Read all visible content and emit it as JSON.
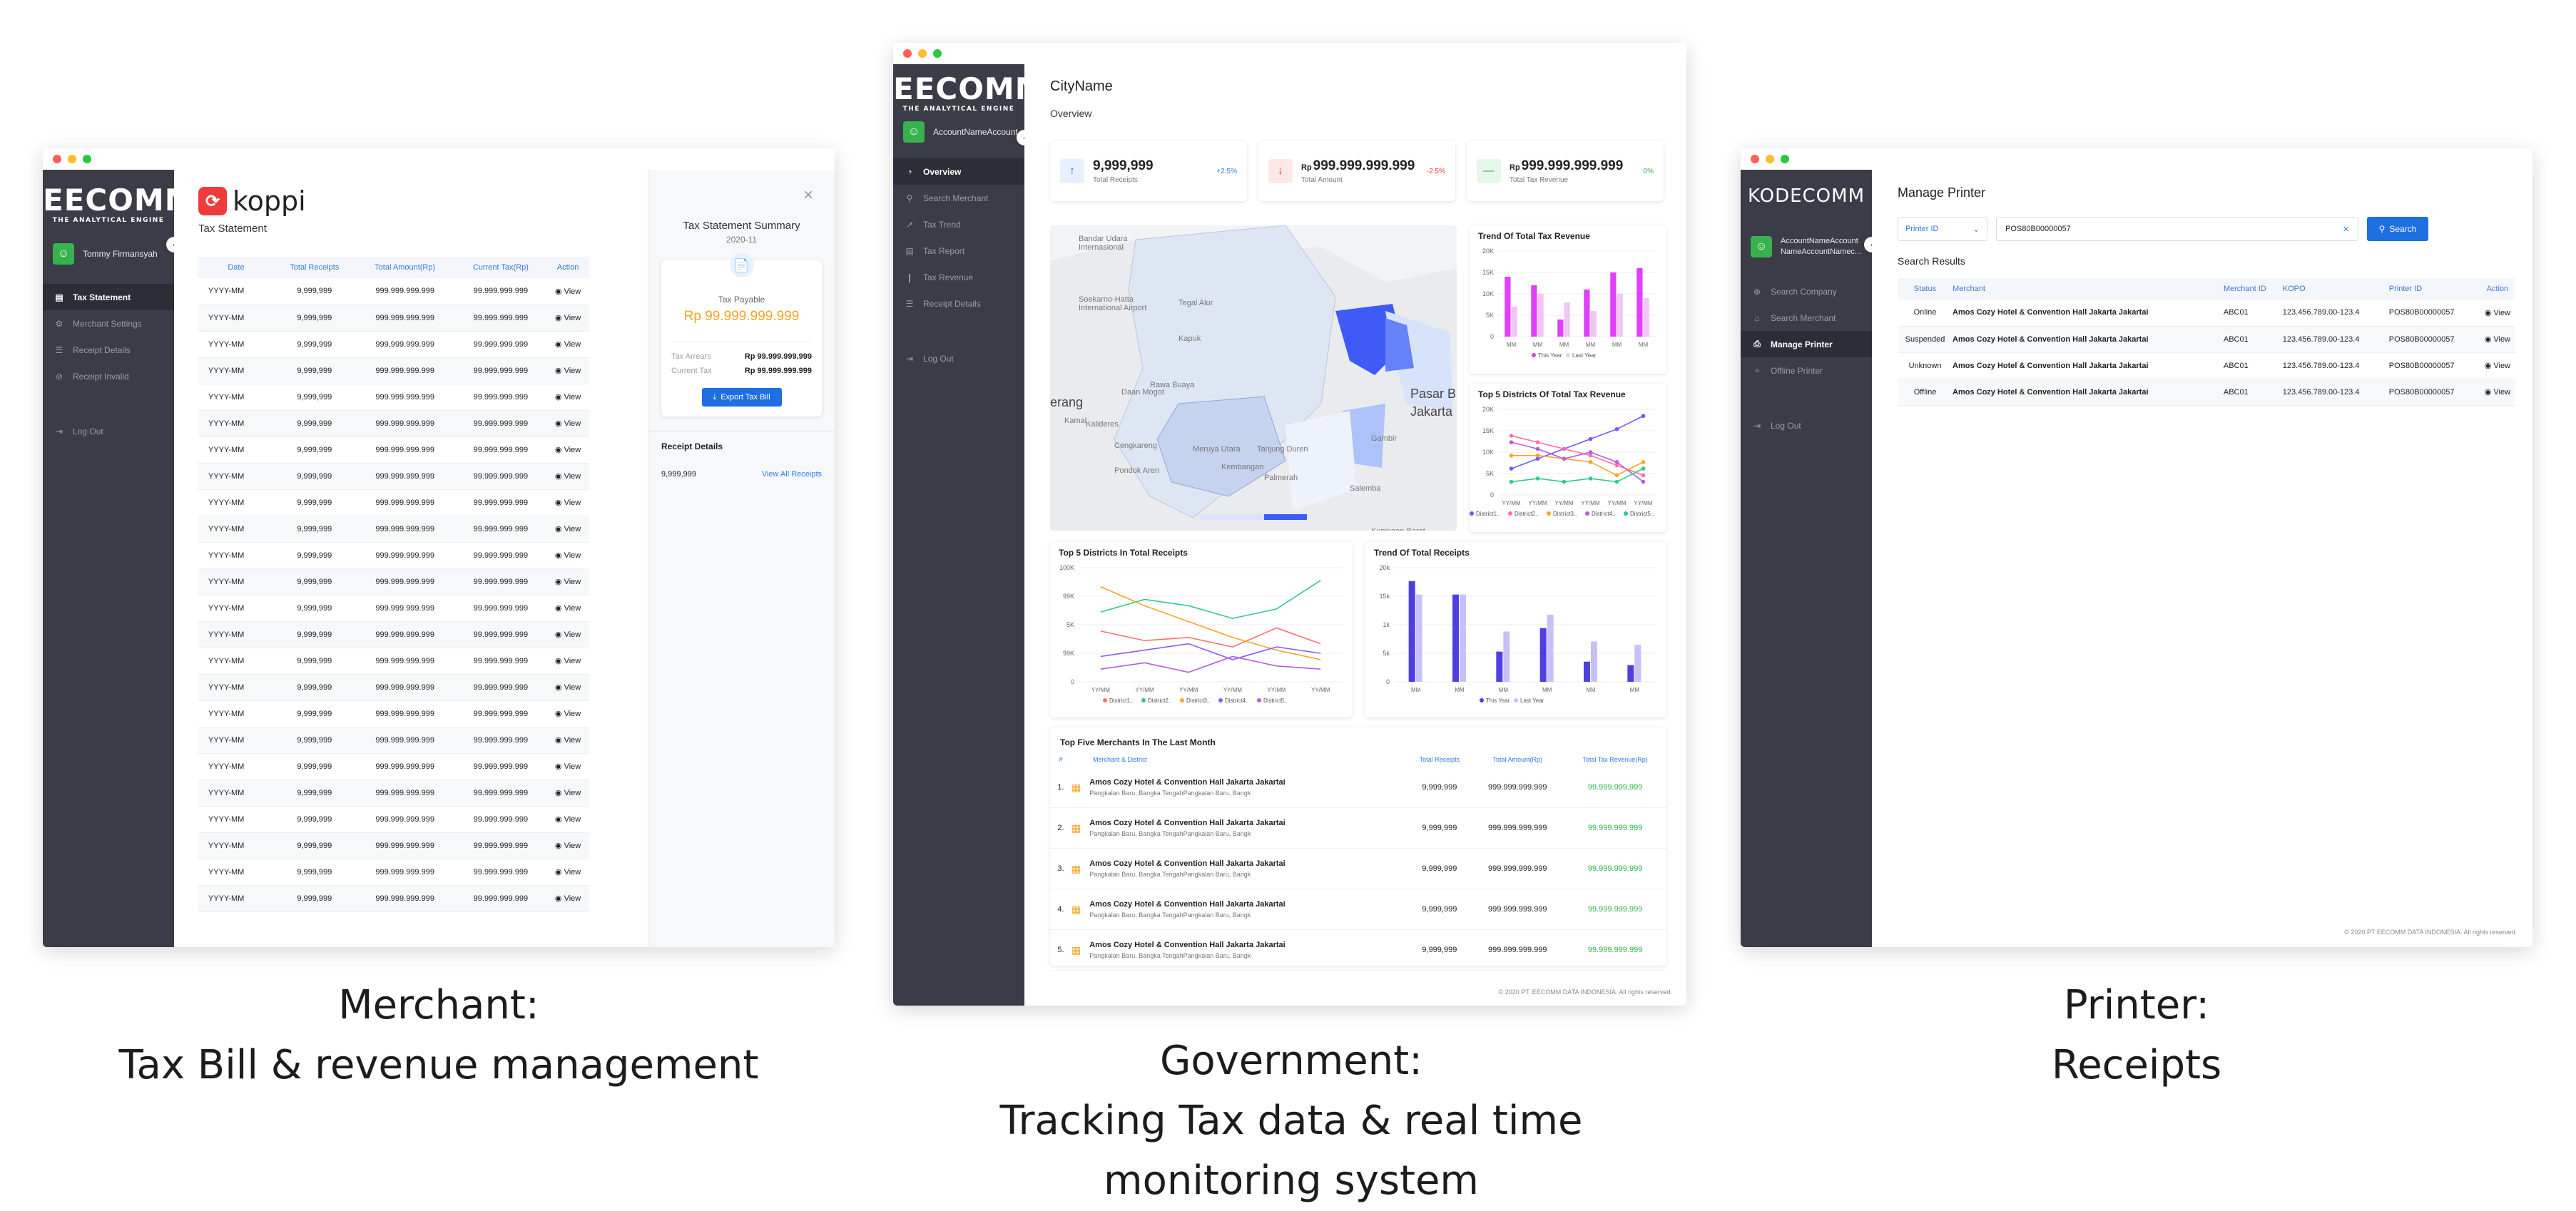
{
  "colors": {
    "sidebar": "#3b3c47",
    "accent": "#1e6fe0",
    "green": "#2fb344",
    "orange": "#f5a524",
    "red": "#e53935",
    "magenta": "#e040fb",
    "purple": "#5b3fe0"
  },
  "captions": {
    "merchant": [
      "Merchant:",
      "Tax Bill & revenue management"
    ],
    "government": [
      "Government:",
      "Tracking Tax data & real time",
      "monitoring system"
    ],
    "printer": [
      "Printer:",
      "Receipts"
    ]
  },
  "merchant": {
    "logo": "EECOMM",
    "logo_tag": "THE ANALYTICAL ENGINE",
    "user": "Tommy Firmansyah",
    "nav": [
      {
        "label": "Tax Statement",
        "icon": "document-icon",
        "active": true
      },
      {
        "label": "Merchant Settings",
        "icon": "gear-icon"
      },
      {
        "label": "Receipt Details",
        "icon": "receipt-icon"
      },
      {
        "label": "Receipt Invalid",
        "icon": "block-icon"
      }
    ],
    "logout": "Log Out",
    "brand": "koppi",
    "page_title": "Tax Statement",
    "headers": [
      "Date",
      "Total Receipts",
      "Total Amount(Rp)",
      "Current Tax(Rp)",
      "Action"
    ],
    "row": {
      "date": "YYYY-MM",
      "receipts": "9,999,999",
      "amount": "999.999.999.999",
      "tax": "99.999.999.999",
      "action": "View"
    },
    "row_count": 24,
    "summary": {
      "title": "Tax Statement Summary",
      "period": "2020-11",
      "payable_label": "Tax Payable",
      "payable": "Rp 99.999.999.999",
      "arrears_label": "Tax Arrears",
      "arrears": "Rp 99.999.999.999",
      "current_label": "Current Tax",
      "current": "Rp 99.999.999.999",
      "export": "Export Tax Bill",
      "receipt_title": "Receipt Details",
      "receipt_value": "9,999,999",
      "view_all": "View All Receipts"
    }
  },
  "government": {
    "logo": "EECOMM",
    "logo_tag": "THE ANALYTICAL ENGINE",
    "user": "AccountNameAccount",
    "nav": [
      {
        "label": "Overview",
        "icon": "pie-icon",
        "active": true
      },
      {
        "label": "Search Merchant",
        "icon": "search-icon"
      },
      {
        "label": "Tax Trend",
        "icon": "trend-icon"
      },
      {
        "label": "Tax Report",
        "icon": "report-icon"
      },
      {
        "label": "Tax Revenue",
        "icon": "bar-chart-icon"
      },
      {
        "label": "Receipt Details",
        "icon": "receipt-icon"
      }
    ],
    "logout": "Log Out",
    "city": "CityName",
    "overview": "Overview",
    "kpis": [
      {
        "value": "9,999,999",
        "label": "Total Receipts",
        "delta": "+2.5%",
        "dir": "up",
        "color": "#2f7bea"
      },
      {
        "value": "999.999.999.999",
        "prefix": "Rp",
        "label": "Total Amount",
        "delta": "-2.5%",
        "dir": "down",
        "color": "#e53935"
      },
      {
        "value": "999.999.999.999",
        "prefix": "Rp",
        "label": "Total Tax Revenue",
        "delta": "0%",
        "dir": "flat",
        "color": "#2fb344"
      }
    ],
    "map_labels": [
      "Bandar Udara",
      "Internasional",
      "Soekarno-Hatta",
      "International Airport",
      "Tegal Alur",
      "erang",
      "Pasar B",
      "Jakarta",
      "Kalideres",
      "Kamal",
      "Rawa Buaya",
      "Daan Mogot",
      "Cengkareng",
      "Meruya Utara",
      "Kapuk",
      "Tanjung Duren",
      "Gambir",
      "Kembangan",
      "Palmerah",
      "Pondok Aren",
      "Salemba",
      "Kuningan Barat"
    ],
    "footer": "© 2020 PT. EECOMM DATA INDONESIA. All rights reserved."
  },
  "printer": {
    "logo": "KODECOMM",
    "user": "AccountNameAccount NameAccountNamec...",
    "nav": [
      {
        "label": "Search Company",
        "icon": "globe-icon"
      },
      {
        "label": "Search Merchant",
        "icon": "store-icon"
      },
      {
        "label": "Manage Printer",
        "icon": "printer-icon",
        "active": true
      },
      {
        "label": "Offline Printer",
        "icon": "wifi-off-icon"
      }
    ],
    "logout": "Log Out",
    "title": "Manage Printer",
    "filter": "Printer ID",
    "search_value": "POS80B00000057",
    "search_btn": "Search",
    "results_title": "Search Results",
    "headers": [
      "Status",
      "Merchant",
      "Merchant ID",
      "KOPO",
      "Printer ID",
      "Action"
    ],
    "rows": [
      {
        "status": "Online",
        "cls": "green",
        "merchant": "Amos Cozy Hotel & Convention Hall Jakarta Jakartai",
        "mid": "ABC01",
        "kopo": "123.456.789.00-123.4",
        "pid": "POS80B00000057",
        "action": "View"
      },
      {
        "status": "Suspended",
        "cls": "grey",
        "merchant": "Amos Cozy Hotel & Convention Hall Jakarta Jakartai",
        "mid": "ABC01",
        "kopo": "123.456.789.00-123.4",
        "pid": "POS80B00000057",
        "action": "View"
      },
      {
        "status": "Unknown",
        "cls": "orange",
        "merchant": "Amos Cozy Hotel & Convention Hall Jakarta Jakartai",
        "mid": "ABC01",
        "kopo": "123.456.789.00-123.4",
        "pid": "POS80B00000057",
        "action": "View"
      },
      {
        "status": "Offline",
        "cls": "red",
        "merchant": "Amos Cozy Hotel & Convention Hall Jakarta Jakartai",
        "mid": "ABC01",
        "kopo": "123.456.789.00-123.4",
        "pid": "POS80B00000057",
        "action": "View"
      }
    ],
    "footer": "© 2020 PT EECOMM DATA INDONESIA. All rights reserved."
  },
  "chart_data": [
    {
      "type": "bar",
      "title": "Trend Of Total Tax Revenue",
      "categories": [
        "MM",
        "MM",
        "MM",
        "MM",
        "MM",
        "MM"
      ],
      "series": [
        {
          "name": "This Year",
          "color": "#e040fb",
          "values": [
            140,
            120,
            40,
            110,
            150,
            160
          ]
        },
        {
          "name": "Last Year",
          "color": "#f3c4f7",
          "values": [
            70,
            100,
            80,
            60,
            100,
            90
          ]
        }
      ],
      "yticks": [
        "20K",
        "15K",
        "10K",
        "5K",
        "0"
      ],
      "ylim": [
        0,
        200
      ]
    },
    {
      "type": "line",
      "title": "Top 5 Districts Of Total Tax Revenue",
      "categories": [
        "YY/MM",
        "YY/MM",
        "YY/MM",
        "YY/MM",
        "YY/MM",
        "YY/MM"
      ],
      "series": [
        {
          "name": "District1..",
          "color": "#6a5cff",
          "values": [
            40,
            55,
            70,
            85,
            100,
            120
          ]
        },
        {
          "name": "District2..",
          "color": "#ff6fa3",
          "values": [
            90,
            80,
            70,
            60,
            45,
            30
          ]
        },
        {
          "name": "District3..",
          "color": "#f5a524",
          "values": [
            60,
            60,
            55,
            50,
            30,
            50
          ]
        },
        {
          "name": "District4..",
          "color": "#b35de0",
          "values": [
            80,
            70,
            55,
            65,
            50,
            20
          ]
        },
        {
          "name": "District5..",
          "color": "#2fcb8a",
          "values": [
            20,
            25,
            20,
            25,
            20,
            40
          ]
        }
      ],
      "yticks": [
        "20K",
        "15K",
        "10K",
        "5K",
        "0"
      ],
      "ylim": [
        0,
        130
      ]
    },
    {
      "type": "line",
      "title": "Top 5 Districts In Total Receipts",
      "categories": [
        "YY/MM",
        "YY/MM",
        "YY/MM",
        "YY/MM",
        "YY/MM",
        "YY/MM"
      ],
      "series": [
        {
          "name": "District1..",
          "color": "#ff6f6f",
          "values": [
            80,
            65,
            70,
            55,
            85,
            60
          ]
        },
        {
          "name": "District2..",
          "color": "#2fcb8a",
          "values": [
            110,
            130,
            120,
            100,
            115,
            160
          ]
        },
        {
          "name": "District3..",
          "color": "#f5a524",
          "values": [
            150,
            120,
            95,
            70,
            50,
            35
          ]
        },
        {
          "name": "District4..",
          "color": "#8a5cff",
          "values": [
            40,
            50,
            60,
            35,
            55,
            45
          ]
        },
        {
          "name": "District5..",
          "color": "#b35de0",
          "values": [
            20,
            30,
            15,
            40,
            25,
            20
          ]
        }
      ],
      "yticks": [
        "100K",
        "99K",
        "5K",
        "99K",
        "0"
      ],
      "ylim": [
        0,
        180
      ]
    },
    {
      "type": "bar",
      "title": "Trend Of Total Receipts",
      "categories": [
        "MM",
        "MM",
        "MM",
        "MM",
        "MM",
        "MM"
      ],
      "series": [
        {
          "name": "This Year",
          "color": "#4f3fe3",
          "values": [
            150,
            130,
            45,
            80,
            30,
            25
          ]
        },
        {
          "name": "Last Year",
          "color": "#c7c2f5",
          "values": [
            130,
            130,
            75,
            100,
            60,
            55
          ]
        }
      ],
      "yticks": [
        "20k",
        "15k",
        "1k",
        "5k",
        "0"
      ],
      "ylim": [
        0,
        170
      ]
    }
  ],
  "top_merchants": {
    "title": "Top Five Merchants In The Last Month",
    "headers": [
      "#",
      "Merchant & District",
      "Total Receipts",
      "Total Amount(Rp)",
      "Total Tax Revenue(Rp)"
    ],
    "row": {
      "name": "Amos Cozy Hotel & Convention Hall Jakarta Jakartai",
      "district": "Pangkalan Baru, Bangka TengahPangkalan Baru, Bangk",
      "receipts": "9,999,999",
      "amount": "999.999.999.999",
      "tax": "99.999.999.999"
    },
    "ranks": [
      "1.",
      "2.",
      "3.",
      "4.",
      "5."
    ]
  }
}
